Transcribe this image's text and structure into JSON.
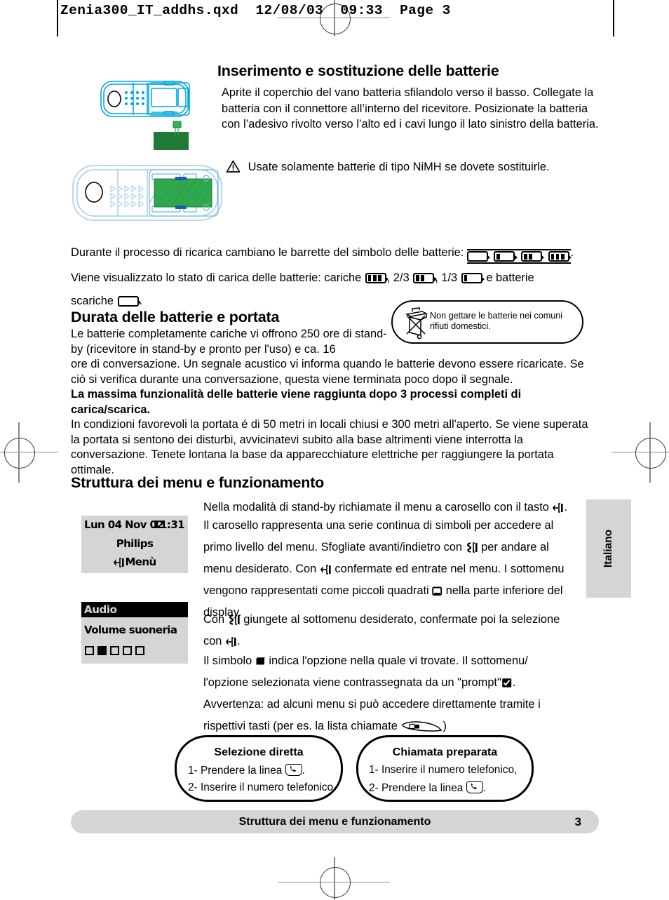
{
  "prepress": {
    "header": "Zenia300_IT_addhs.qxd  12/08/03  09:33  Page 3"
  },
  "sections": {
    "battery_title": "Inserimento e sostituzione delle batterie",
    "battery_intro": "Aprite il coperchio del vano batteria sfilandolo verso il basso. Collegate la batteria con il connettore all’interno del ricevitore. Posizionate la batteria con l’adesivo rivolto verso l’alto ed i cavi lungo il lato sinistro della batteria.",
    "battery_warning": "Usate solamente batterie di tipo NiMH se dovete sostituirle.",
    "charging_line_pre": "Durante il processo di ricarica cambiano le barrette del simbolo delle batterie:",
    "charging_line_post": ".",
    "state_pre": "Viene visualizzato lo stato di carica delle batterie: cariche",
    "state_mid1": ", 2/3",
    "state_mid2": ", 1/3",
    "state_mid3": "e batterie",
    "state_end_pre": "scariche",
    "state_end_post": ".",
    "duration_title": "Durata delle batterie e portata",
    "duration_p1": "Le batterie completamente cariche vi offrono 250 ore di stand-by (ricevitore in stand-by e pronto per l'uso) e ca. 16",
    "duration_p2": "ore di conversazione. Un segnale acustico vi informa quando le batterie devono essere ricaricate. Se ciò si verifica durante una conversazione, questa viene terminata poco dopo il segnale.",
    "duration_bold": "La massima funzionalità delle batterie viene raggiunta dopo 3 processi completi di carica/scarica.",
    "duration_p3": "In condizioni favorevoli la portata é di 50 metri in locali chiusi e 300 metri all'aperto. Se viene superata la portata si sentono dei disturbi, avvicinatevi subito alla base altrimenti viene interrotta la conversazione. Tenete lontana la base da apparecchiature elettriche per raggiungere la portata ottimale.",
    "menu_title": "Struttura dei menu e funzionamento"
  },
  "recycle_bubble": {
    "line1": "Non gettare le batterie nei comuni",
    "line2": "rifiuti domestici."
  },
  "menu_text": {
    "l1a": "Nella modalità di stand-by richiamate il menu a carosello con il tasto",
    "l1b": ".",
    "l2": "Il carosello rappresenta una serie continua di simboli per accedere al",
    "l3a": "primo livello del menu. Sfogliate avanti/indietro con",
    "l3b": "per andare al",
    "l4a": "menu desiderato. Con",
    "l4b": "confermate ed entrate nel menu. I sottomenu",
    "l5a": "vengono rappresentati come piccoli quadrati",
    "l5b": "nella parte inferiore del",
    "l6": "display.",
    "l7a": "Con",
    "l7b": "giungete al sottomenu desiderato, confermate poi la selezione",
    "l8a": "con",
    "l8b": ".",
    "l9a": "Il simbolo",
    "l9b": "indica l'opzione nella quale vi trovate. Il sottomenu/",
    "l10a": "l'opzione selezionata viene contrassegnata da un \"prompt\"",
    "l10b": ".",
    "l11": "Avvertenza: ad alcuni menu si può accedere direttamente tramite i",
    "l12a": "rispettivi tasti (per es. la lista chiamate",
    "l12b": ")"
  },
  "lcd_standby": {
    "date": "Lun 04 Nov 02",
    "time": "11:31",
    "brand": "Philips",
    "softkey": "Menù"
  },
  "lcd_menu": {
    "header": "Audio",
    "item": "Volume suoneria",
    "squares": [
      false,
      true,
      false,
      false,
      false
    ]
  },
  "language_tab": {
    "label": "Italiano"
  },
  "call_bubbles": [
    {
      "title": "Selezione diretta",
      "step1_pre": "1- Prendere la linea",
      "step1_post": ".",
      "step2": "2- Inserire il numero telefonico."
    },
    {
      "title": "Chiamata preparata",
      "step1": "1- Inserire il numero telefonico,",
      "step2_pre": "2- Prendere la linea",
      "step2_post": "."
    }
  ],
  "footer": {
    "title": "Struttura dei menu e funzionamento",
    "page": "3"
  },
  "icons": {
    "warning_triangle": "warning-triangle-icon",
    "battery_empty": "battery-empty-icon",
    "battery_1": "battery-one-third-icon",
    "battery_2": "battery-two-thirds-icon",
    "battery_full": "battery-full-icon",
    "menu_key": "menu-key-icon",
    "scroll_key": "scroll-key-icon",
    "small_square": "small-square-icon",
    "filled_square": "filled-square-icon",
    "prompt_check": "prompt-checkbox-icon",
    "call_list_key": "call-list-key-icon",
    "pickup_key": "pickup-line-key-icon",
    "trash_crossed": "crossed-out-trash-icon"
  },
  "colors": {
    "lcd_bg": "#d5d5d5",
    "handset_outline": "#00a8e0",
    "battery_green": "#2b8a3e",
    "battery_green_light": "#2fb457",
    "text": "#000000"
  }
}
